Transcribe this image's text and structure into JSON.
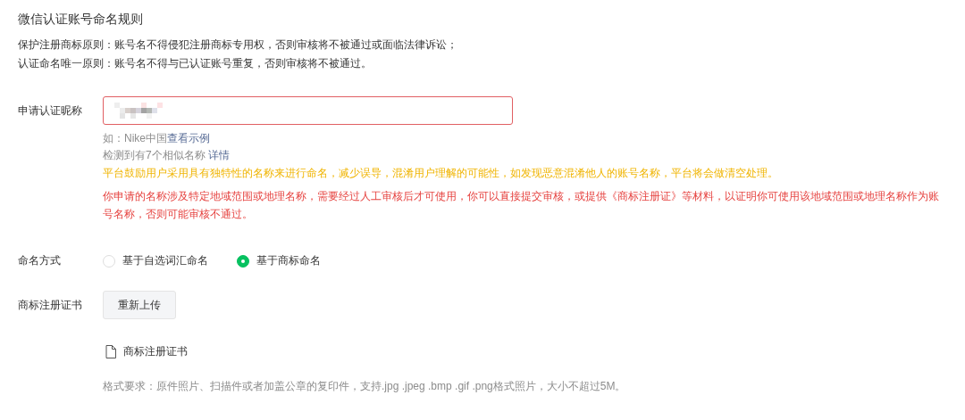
{
  "title": "微信认证账号命名规则",
  "rules": [
    "保护注册商标原则：账号名不得侵犯注册商标专用权，否则审核将不被通过或面临法律诉讼；",
    "认证命名唯一原则：账号名不得与已认证账号重复，否则审核将不被通过。"
  ],
  "nickname": {
    "label": "申请认证昵称",
    "error": true,
    "hints": [
      {
        "text": "如：Nike中国",
        "link": "查看示例"
      },
      {
        "text": "检测到有7个相似名称 ",
        "link": "详情"
      }
    ],
    "notice": "平台鼓励用户采用具有独特性的名称来进行命名，减少误导，混淆用户理解的可能性，如发现恶意混淆他人的账号名称，平台将会做清空处理。",
    "warning": "你申请的名称涉及特定地域范围或地理名称，需要经过人工审核后才可使用，你可以直接提交审核，或提供《商标注册证》等材料，以证明你可使用该地域范围或地理名称作为账号名称，否则可能审核不通过。"
  },
  "naming": {
    "label": "命名方式",
    "options": [
      {
        "label": "基于自选词汇命名",
        "selected": false
      },
      {
        "label": "基于商标命名",
        "selected": true
      }
    ]
  },
  "certificate": {
    "label": "商标注册证书",
    "button": "重新上传",
    "file": "商标注册证书",
    "requirement": "格式要求：原件照片、扫描件或者加盖公章的复印件，支持.jpg .jpeg .bmp .gif .png格式照片，大小不超过5M。"
  }
}
